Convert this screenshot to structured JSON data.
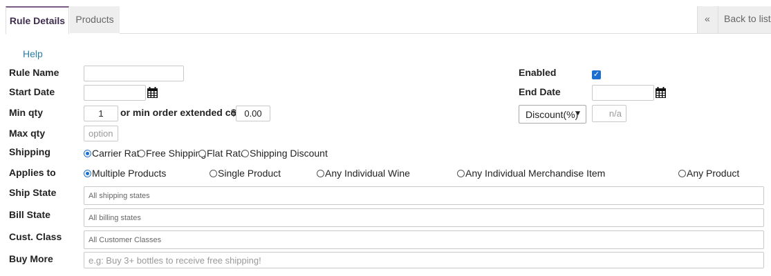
{
  "tabs": {
    "rule_details": "Rule Details",
    "products": "Products",
    "back_chevron": "«",
    "back_label": "Back to list"
  },
  "help_label": "Help",
  "labels": {
    "rule_name": "Rule Name",
    "start_date": "Start Date",
    "min_qty": "Min qty",
    "or_min_order": "or min order extended cost",
    "currency": "$",
    "max_qty": "Max qty",
    "shipping": "Shipping",
    "applies_to": "Applies to",
    "ship_state": "Ship State",
    "bill_state": "Bill State",
    "cust_class": "Cust. Class",
    "buy_more": "Buy More",
    "enabled": "Enabled",
    "end_date": "End Date"
  },
  "fields": {
    "rule_name": "",
    "start_date": "",
    "end_date": "",
    "min_qty": "1",
    "min_order_cost": "0.00",
    "max_qty_placeholder": "optional",
    "discount_select": "Discount(%)",
    "discount_value_placeholder": "n/a",
    "ship_state_placeholder": "All shipping states",
    "bill_state_placeholder": "All billing states",
    "cust_class_placeholder": "All Customer Classes",
    "buy_more_placeholder": "e.g: Buy 3+ bottles to receive free shipping!",
    "enabled_checked": true
  },
  "shipping_options": {
    "carrier_rate": "Carrier Rate",
    "free_shipping": "Free Shipping",
    "flat_rate": "Flat Rate",
    "shipping_discount": "Shipping Discount",
    "selected": "Carrier Rate"
  },
  "applies_options": {
    "multiple_products": "Multiple Products",
    "single_product": "Single Product",
    "any_individual_wine": "Any Individual Wine",
    "any_individual_merch": "Any Individual Merchandise Item",
    "any_product": "Any Product",
    "selected": "Multiple Products"
  },
  "colors": {
    "accent": "#1a6fd0",
    "tab_active_text": "#3f2d4f",
    "help_link": "#2b7da6"
  },
  "icons": {
    "calendar": "calendar-icon",
    "chevron": "chevron-down-icon"
  }
}
